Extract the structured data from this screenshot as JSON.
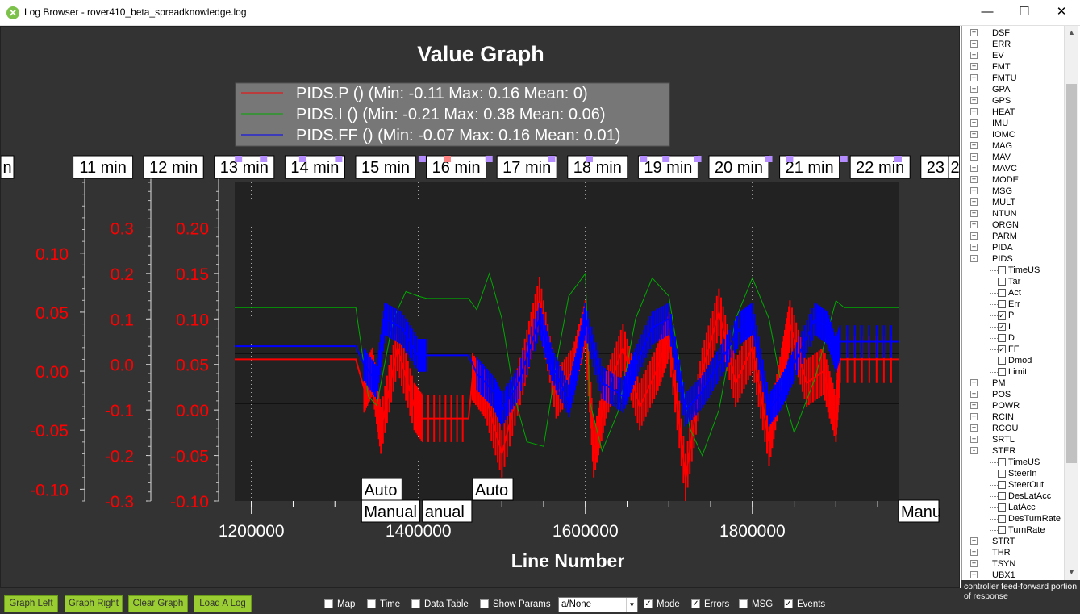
{
  "window": {
    "title": "Log Browser - rover410_beta_spreadknowledge.log",
    "app_icon": "ardupilot-x-icon",
    "minimize_glyph": "—",
    "maximize_glyph": "☐",
    "close_glyph": "✕"
  },
  "chart_data": {
    "type": "line",
    "title": "Value Graph",
    "xlabel": "Line Number",
    "x_ticks": [
      "1200000",
      "1400000",
      "1600000",
      "1800000"
    ],
    "xlim": [
      1180000,
      1975000
    ],
    "series": [
      {
        "name": "PIDS.P () (Min: -0.11 Max: 0.16 Mean: 0)",
        "color": "#ff0000",
        "axis": 0,
        "y_ticks": [
          "0.10",
          "0.05",
          "0.00",
          "-0.05",
          "-0.10"
        ],
        "ylim": [
          -0.11,
          0.16
        ],
        "x": [
          1180000,
          1325000,
          1335000,
          1345000,
          1355000,
          1375000,
          1395000,
          1405000,
          1460000,
          1465000,
          1480000,
          1500000,
          1525000,
          1545000,
          1565000,
          1585000,
          1600000,
          1610000,
          1625000,
          1645000,
          1665000,
          1685000,
          1700000,
          1720000,
          1740000,
          1760000,
          1780000,
          1800000,
          1820000,
          1835000,
          1845000,
          1865000,
          1885000,
          1900000,
          1905000,
          1975000
        ],
        "y": [
          0.01,
          0.01,
          -0.015,
          0.0,
          -0.05,
          0.02,
          -0.03,
          -0.04,
          -0.04,
          -0.005,
          -0.02,
          -0.07,
          0.0,
          0.06,
          -0.02,
          0.0,
          0.04,
          -0.07,
          -0.02,
          0.02,
          -0.03,
          0.0,
          0.03,
          -0.09,
          0.0,
          0.05,
          -0.01,
          0.02,
          -0.06,
          0.0,
          0.04,
          -0.01,
          0.0,
          -0.04,
          0.01,
          0.01
        ]
      },
      {
        "name": "PIDS.I () (Min: -0.21 Max: 0.38 Mean: 0.06)",
        "color": "#00aa00",
        "axis": 1,
        "y_ticks": [
          "0.3",
          "0.2",
          "0.1",
          "0.0",
          "-0.1",
          "-0.2",
          "-0.3"
        ],
        "ylim": [
          -0.3,
          0.4
        ],
        "x": [
          1180000,
          1325000,
          1340000,
          1350000,
          1370000,
          1385000,
          1400000,
          1410000,
          1460000,
          1470000,
          1485000,
          1500000,
          1515000,
          1530000,
          1550000,
          1565000,
          1580000,
          1600000,
          1605000,
          1620000,
          1640000,
          1660000,
          1680000,
          1700000,
          1725000,
          1740000,
          1760000,
          1780000,
          1800000,
          1820000,
          1835000,
          1850000,
          1875000,
          1900000,
          1910000,
          1975000
        ],
        "y": [
          0.125,
          0.125,
          -0.07,
          -0.09,
          0.1,
          0.16,
          0.15,
          0.145,
          0.145,
          0.12,
          0.2,
          0.1,
          -0.07,
          -0.17,
          -0.18,
          0.0,
          0.15,
          0.2,
          -0.08,
          -0.19,
          -0.1,
          0.1,
          0.19,
          0.15,
          -0.14,
          -0.2,
          -0.1,
          0.1,
          0.19,
          0.1,
          -0.05,
          -0.15,
          -0.03,
          0.14,
          0.125,
          0.125
        ]
      },
      {
        "name": "PIDS.FF () (Min: -0.07 Max: 0.16 Mean: 0.01)",
        "color": "#0000ff",
        "axis": 2,
        "y_ticks": [
          "0.20",
          "0.15",
          "0.10",
          "0.05",
          "0.00",
          "-0.05",
          "-0.10"
        ],
        "ylim": [
          -0.1,
          0.25
        ],
        "x": [
          1180000,
          1325000,
          1335000,
          1350000,
          1360000,
          1380000,
          1400000,
          1410000,
          1460000,
          1470000,
          1490000,
          1500000,
          1520000,
          1545000,
          1560000,
          1580000,
          1590000,
          1600000,
          1620000,
          1645000,
          1660000,
          1680000,
          1700000,
          1720000,
          1740000,
          1760000,
          1785000,
          1800000,
          1820000,
          1835000,
          1850000,
          1875000,
          1890000,
          1900000,
          1905000,
          1975000
        ],
        "y": [
          0.07,
          0.07,
          0.05,
          0.03,
          0.1,
          0.09,
          0.06,
          0.06,
          0.06,
          0.04,
          0.02,
          0.0,
          0.03,
          0.1,
          0.05,
          0.01,
          0.05,
          0.1,
          0.03,
          0.015,
          0.05,
          0.09,
          0.1,
          0.0,
          0.02,
          0.05,
          0.09,
          0.1,
          0.0,
          0.02,
          0.05,
          0.1,
          0.09,
          0.06,
          0.075,
          0.075
        ]
      }
    ],
    "time_labels": [
      "n",
      "11 min",
      "12 min",
      "13 min",
      "14 min",
      "15 min",
      "16 min",
      "17 min",
      "18 min",
      "19 min",
      "20 min",
      "21 min",
      "22 min",
      "23 min",
      "2"
    ],
    "mode_labels": [
      {
        "text": "Auto",
        "x": 1332000,
        "row": 0
      },
      {
        "text": "Manual",
        "x": 1332000,
        "row": 1
      },
      {
        "text": "anual",
        "x": 1405000,
        "row": 1
      },
      {
        "text": "Auto",
        "x": 1465000,
        "row": 0
      },
      {
        "text": "Manu",
        "x": 1975000,
        "row": 1
      }
    ],
    "event_markers": [
      1185000,
      1215000,
      1262000,
      1305000,
      1405000,
      1485000,
      1560000,
      1605000,
      1670000,
      1697000,
      1735000,
      1820000,
      1845000,
      1910000,
      1975000
    ],
    "error_markers": [
      1435000
    ],
    "legend_position": "top-center",
    "grid": false
  },
  "tree": {
    "items": [
      {
        "label": "DSF",
        "level": 0,
        "toggle": "+"
      },
      {
        "label": "ERR",
        "level": 0,
        "toggle": "+"
      },
      {
        "label": "EV",
        "level": 0,
        "toggle": "+"
      },
      {
        "label": "FMT",
        "level": 0,
        "toggle": "+"
      },
      {
        "label": "FMTU",
        "level": 0,
        "toggle": "+"
      },
      {
        "label": "GPA",
        "level": 0,
        "toggle": "+"
      },
      {
        "label": "GPS",
        "level": 0,
        "toggle": "+"
      },
      {
        "label": "HEAT",
        "level": 0,
        "toggle": "+"
      },
      {
        "label": "IMU",
        "level": 0,
        "toggle": "+"
      },
      {
        "label": "IOMC",
        "level": 0,
        "toggle": "+"
      },
      {
        "label": "MAG",
        "level": 0,
        "toggle": "+"
      },
      {
        "label": "MAV",
        "level": 0,
        "toggle": "+"
      },
      {
        "label": "MAVC",
        "level": 0,
        "toggle": "+"
      },
      {
        "label": "MODE",
        "level": 0,
        "toggle": "+"
      },
      {
        "label": "MSG",
        "level": 0,
        "toggle": "+"
      },
      {
        "label": "MULT",
        "level": 0,
        "toggle": "+"
      },
      {
        "label": "NTUN",
        "level": 0,
        "toggle": "+"
      },
      {
        "label": "ORGN",
        "level": 0,
        "toggle": "+"
      },
      {
        "label": "PARM",
        "level": 0,
        "toggle": "+"
      },
      {
        "label": "PIDA",
        "level": 0,
        "toggle": "+"
      },
      {
        "label": "PIDS",
        "level": 0,
        "toggle": "-"
      },
      {
        "label": "TimeUS",
        "level": 1,
        "checked": false
      },
      {
        "label": "Tar",
        "level": 1,
        "checked": false
      },
      {
        "label": "Act",
        "level": 1,
        "checked": false
      },
      {
        "label": "Err",
        "level": 1,
        "checked": false
      },
      {
        "label": "P",
        "level": 1,
        "checked": true
      },
      {
        "label": "I",
        "level": 1,
        "checked": true
      },
      {
        "label": "D",
        "level": 1,
        "checked": false
      },
      {
        "label": "FF",
        "level": 1,
        "checked": true
      },
      {
        "label": "Dmod",
        "level": 1,
        "checked": false
      },
      {
        "label": "Limit",
        "level": 1,
        "checked": false
      },
      {
        "label": "PM",
        "level": 0,
        "toggle": "+"
      },
      {
        "label": "POS",
        "level": 0,
        "toggle": "+"
      },
      {
        "label": "POWR",
        "level": 0,
        "toggle": "+"
      },
      {
        "label": "RCIN",
        "level": 0,
        "toggle": "+"
      },
      {
        "label": "RCOU",
        "level": 0,
        "toggle": "+"
      },
      {
        "label": "SRTL",
        "level": 0,
        "toggle": "+"
      },
      {
        "label": "STER",
        "level": 0,
        "toggle": "-"
      },
      {
        "label": "TimeUS",
        "level": 1,
        "checked": false
      },
      {
        "label": "SteerIn",
        "level": 1,
        "checked": false
      },
      {
        "label": "SteerOut",
        "level": 1,
        "checked": false
      },
      {
        "label": "DesLatAcc",
        "level": 1,
        "checked": false
      },
      {
        "label": "LatAcc",
        "level": 1,
        "checked": false
      },
      {
        "label": "DesTurnRate",
        "level": 1,
        "checked": false
      },
      {
        "label": "TurnRate",
        "level": 1,
        "checked": false
      },
      {
        "label": "STRT",
        "level": 0,
        "toggle": "+"
      },
      {
        "label": "THR",
        "level": 0,
        "toggle": "+"
      },
      {
        "label": "TSYN",
        "level": 0,
        "toggle": "+"
      },
      {
        "label": "UBX1",
        "level": 0,
        "toggle": "+"
      }
    ],
    "description": "controller feed-forward portion of response",
    "scroll_up_icon": "▲",
    "scroll_down_icon": "▼"
  },
  "toolbar": {
    "buttons": [
      {
        "label": "Graph Left",
        "name": "graph-left-button"
      },
      {
        "label": "Graph Right",
        "name": "graph-right-button"
      },
      {
        "label": "Clear Graph",
        "name": "clear-graph-button"
      },
      {
        "label": "Load A Log",
        "name": "load-a-log-button"
      }
    ],
    "options": [
      {
        "label": "Map",
        "checked": false,
        "name": "map-checkbox"
      },
      {
        "label": "Time",
        "checked": false,
        "name": "time-checkbox"
      },
      {
        "label": "Data Table",
        "checked": false,
        "name": "data-table-checkbox"
      },
      {
        "label": "Show Params",
        "checked": false,
        "name": "show-params-checkbox"
      },
      {
        "label": "Mode",
        "checked": true,
        "name": "mode-checkbox"
      },
      {
        "label": "Errors",
        "checked": true,
        "name": "errors-checkbox"
      },
      {
        "label": "MSG",
        "checked": false,
        "name": "msg-checkbox"
      },
      {
        "label": "Events",
        "checked": true,
        "name": "events-checkbox"
      }
    ],
    "select_value": "a/None",
    "select_arrow": "▼"
  },
  "colors": {
    "graph_bg": "#333333",
    "plot_bg": "#222222",
    "axis_red": "#ff0000",
    "button_green": "#9acd32"
  }
}
